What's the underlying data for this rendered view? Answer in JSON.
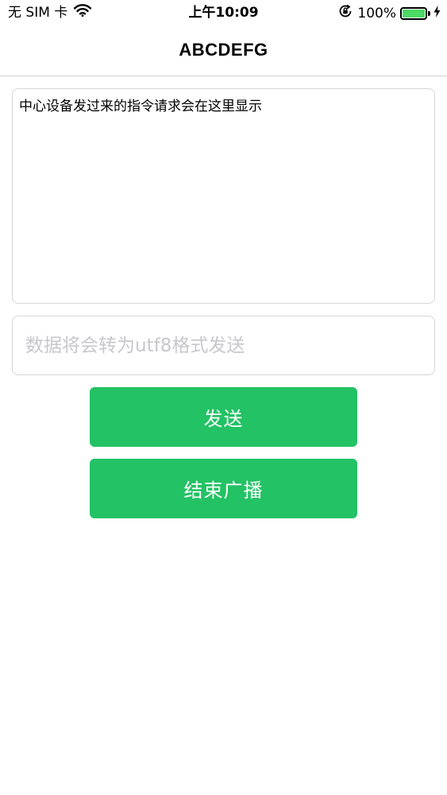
{
  "status_bar": {
    "carrier": "无 SIM 卡",
    "time": "上午10:09",
    "battery_percent": "100%",
    "battery_level": 1.0,
    "battery_color": "#4cd964",
    "icons": [
      "wifi-icon",
      "orientation-lock-icon",
      "battery-icon",
      "charging-bolt-icon"
    ]
  },
  "nav": {
    "title": "ABCDEFG"
  },
  "log": {
    "text": "中心设备发过来的指令请求会在这里显示"
  },
  "input": {
    "value": "",
    "placeholder": "数据将会转为utf8格式发送"
  },
  "buttons": {
    "send_label": "发送",
    "stop_label": "结束广播",
    "color": "#23c265"
  }
}
